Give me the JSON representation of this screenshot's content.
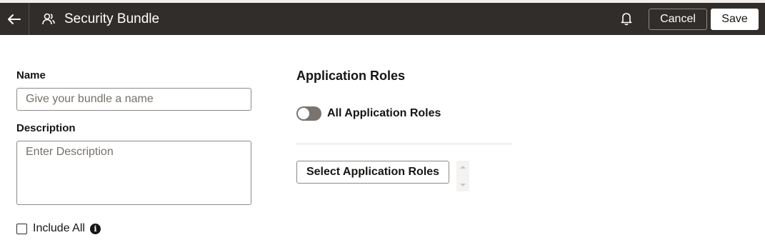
{
  "header": {
    "back_icon": "arrow-left-icon",
    "title_icon": "user-group-icon",
    "title": "Security Bundle",
    "notification_icon": "bell-icon",
    "cancel_label": "Cancel",
    "save_label": "Save",
    "background_color": "#312d2a"
  },
  "form": {
    "name_label": "Name",
    "name_placeholder": "Give your bundle a name",
    "name_value": "",
    "description_label": "Description",
    "description_placeholder": "Enter Description",
    "description_value": "",
    "include_all_label": "Include All",
    "include_all_checked": false,
    "info_icon": "info-icon"
  },
  "application_roles": {
    "title": "Application Roles",
    "all_roles_label": "All Application Roles",
    "all_roles_enabled": false,
    "select_button_label": "Select Application Roles"
  }
}
